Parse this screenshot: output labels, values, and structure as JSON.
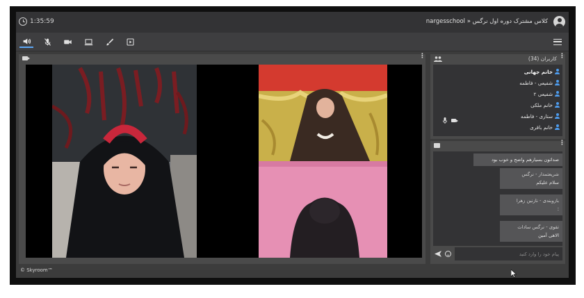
{
  "header": {
    "time": "1:35:59",
    "room_title": "nargesschool » کلاس مشترک دوره اول نرگس"
  },
  "toolbar": {
    "icons": [
      "speaker-icon",
      "mic-off-icon",
      "camera-icon",
      "screen-share-icon",
      "whiteboard-icon",
      "media-player-icon"
    ],
    "active": "speaker-icon"
  },
  "users_panel": {
    "title": "کاربران (34)",
    "users": [
      {
        "name": "خانم جهانی",
        "bold": true
      },
      {
        "name": "شفیعی - فاطمه",
        "bold": false
      },
      {
        "name": "شفیعی ۲",
        "bold": false
      },
      {
        "name": "خانم ملکی",
        "bold": false
      },
      {
        "name": "ستاری - فاطمه",
        "bold": false
      },
      {
        "name": "خانم باقری",
        "bold": false
      }
    ]
  },
  "chat": {
    "messages": [
      {
        "sender": "",
        "text": "صداتون بسیارهم واضح و خوب بود",
        "extra": ""
      },
      {
        "sender": "شریعتمدار - نرگس",
        "text": "سلام علیکم",
        "extra": ""
      },
      {
        "sender": "بازوبندی - نازنین زهرا",
        "text": ":",
        "extra": ""
      },
      {
        "sender": "تقوی - نرگس سادات",
        "text": "الاهی آمین",
        "extra": ""
      }
    ],
    "input_placeholder": "پیام خود را وارد کنید"
  },
  "footer": {
    "copyright": "© Skyroom™"
  },
  "colors": {
    "accent": "#5ba7f7",
    "user_icon": "#4e9df0",
    "panel_bg": "#4a4a4a",
    "header_bg": "#333335"
  }
}
